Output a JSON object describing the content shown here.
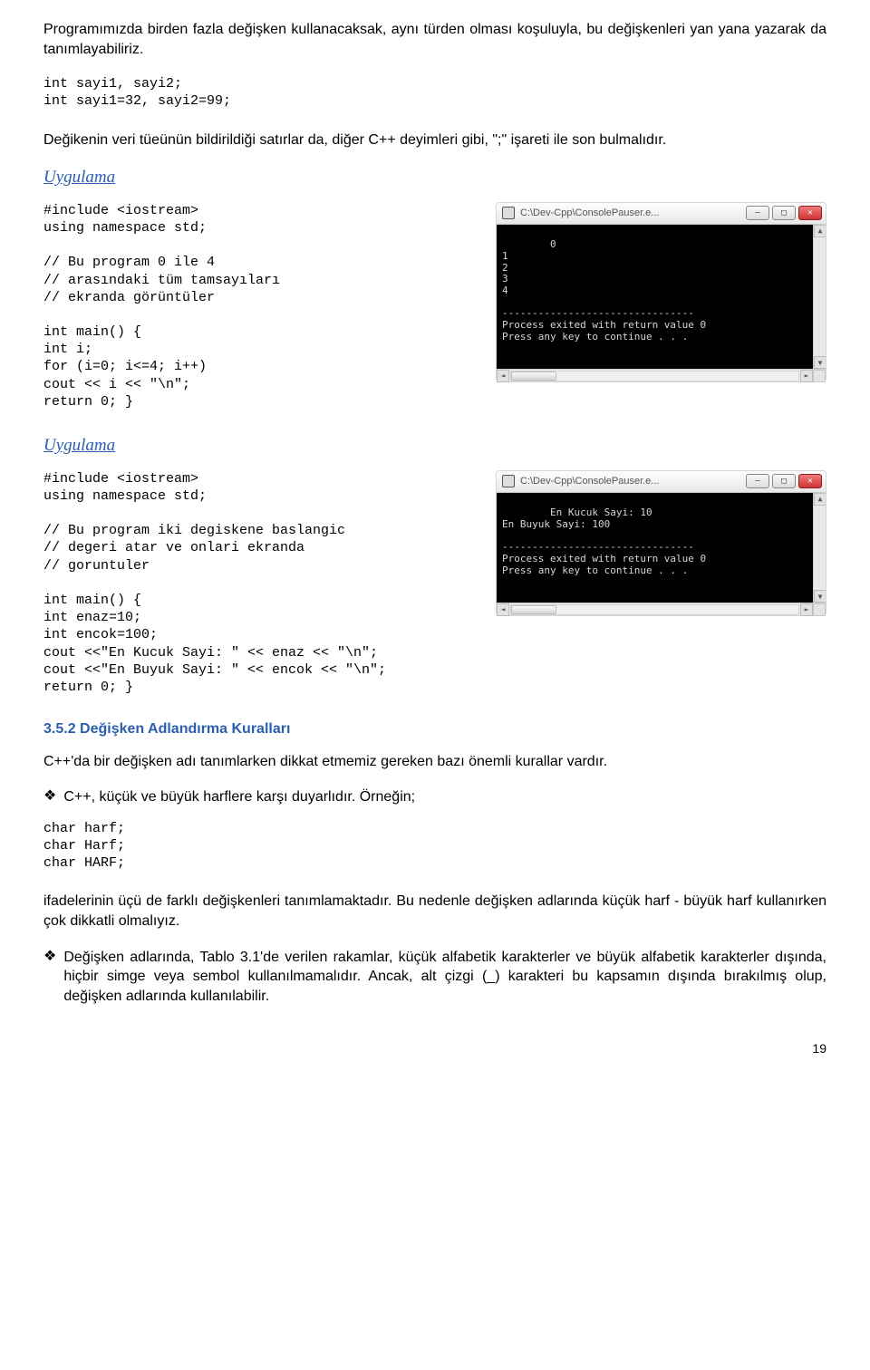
{
  "intro": {
    "p1": "Programımızda birden fazla değişken kullanacaksak, aynı türden olması koşuluyla, bu değişkenleri yan yana yazarak da tanımlayabiliriz.",
    "code1": "int sayi1, sayi2;\nint sayi1=32, sayi2=99;",
    "p2": "Değikenin veri tüeünün bildirildiği satırlar da, diğer C++ deyimleri gibi, \";\" işareti ile son bulmalıdır."
  },
  "ex1": {
    "heading": "Uygulama",
    "code": "#include <iostream>\nusing namespace std;\n\n// Bu program 0 ile 4\n// arasındaki tüm tamsayıları\n// ekranda görüntüler\n\nint main() {\nint i;\nfor (i=0; i<=4; i++)\ncout << i << \"\\n\";\nreturn 0; }",
    "console_title": "C:\\Dev-Cpp\\ConsolePauser.e...",
    "console_out": "0\n1\n2\n3\n4\n\n--------------------------------\nProcess exited with return value 0\nPress any key to continue . . ."
  },
  "ex2": {
    "heading": "Uygulama",
    "code": "#include <iostream>\nusing namespace std;\n\n// Bu program iki degiskene baslangic\n// degeri atar ve onlari ekranda\n// goruntuler\n\nint main() {\nint enaz=10;\nint encok=100;\ncout <<\"En Kucuk Sayi: \" << enaz << \"\\n\";\ncout <<\"En Buyuk Sayi: \" << encok << \"\\n\";\nreturn 0; }",
    "console_title": "C:\\Dev-Cpp\\ConsolePauser.e...",
    "console_out": "En Kucuk Sayi: 10\nEn Buyuk Sayi: 100\n\n--------------------------------\nProcess exited with return value 0\nPress any key to continue . . ."
  },
  "section": {
    "heading": "3.5.2 Değişken Adlandırma Kuralları",
    "p1": "C++'da bir değişken adı tanımlarken dikkat etmemiz gereken bazı önemli kurallar vardır.",
    "bullet1": "C++, küçük ve büyük harflere karşı duyarlıdır. Örneğin;",
    "code": "char harf;\nchar Harf;\nchar HARF;",
    "p2": "ifadelerinin üçü de farklı değişkenleri tanımlamaktadır. Bu nedenle değişken adlarında küçük harf - büyük harf kullanırken çok dikkatli olmalıyız.",
    "bullet2": "Değişken adlarında, Tablo 3.1'de verilen rakamlar, küçük alfabetik karakterler ve büyük alfabetik karakterler dışında, hiçbir simge veya sembol kullanılmamalıdır. Ancak, alt çizgi (_) karakteri bu kapsamın dışında bırakılmış olup, değişken adlarında kullanılabilir."
  },
  "page_number": "19",
  "win": {
    "min": "–",
    "max": "□",
    "close": "✕",
    "up": "▲",
    "down": "▼",
    "left": "◄",
    "right": "►"
  }
}
